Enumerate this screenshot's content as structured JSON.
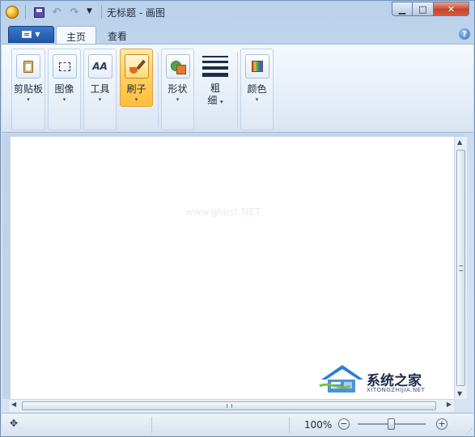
{
  "window": {
    "title": "无标题 - 画图",
    "controls": {
      "minimize_icon": "minimize-icon",
      "maximize_icon": "maximize-icon",
      "close_icon": "close-icon"
    }
  },
  "quick_access": {
    "buttons": [
      "save-icon",
      "undo-icon",
      "redo-icon",
      "customize-dropdown-icon"
    ]
  },
  "ribbon": {
    "app_menu_icon": "paint-menu-icon",
    "tabs": [
      {
        "label": "主页",
        "active": true
      },
      {
        "label": "查看",
        "active": false
      }
    ],
    "help_icon": "help-icon",
    "help_label": "?",
    "groups": [
      {
        "label": "剪贴板",
        "icon": "clipboard-icon"
      },
      {
        "label": "图像",
        "icon": "select-icon"
      },
      {
        "label": "工具",
        "icon": "tools-icon"
      },
      {
        "label": "刷子",
        "icon": "brush-icon",
        "active": true
      },
      {
        "label": "形状",
        "icon": "shapes-icon"
      },
      {
        "label": "粗\n细",
        "label_line1": "粗",
        "label_line2": "细",
        "icon": "line-size-icon"
      },
      {
        "label": "颜色",
        "icon": "colors-icon"
      }
    ],
    "tools_glyph": "AA",
    "caret": "▾"
  },
  "canvas": {
    "background": "#ffffff",
    "watermark_text": "www.ghost.NET"
  },
  "logo": {
    "title": "系统之家",
    "subtitle": "XITONGZHIJIA.NET"
  },
  "status": {
    "move_icon": "move-cursor-icon",
    "zoom_level": "100%",
    "zoom_out_label": "−",
    "zoom_in_label": "+",
    "zoom_fraction": 0.5
  },
  "colors": {
    "accent": "#1f56a8",
    "active_group": "#ffcf5e",
    "frame": "#b9d1ea"
  }
}
